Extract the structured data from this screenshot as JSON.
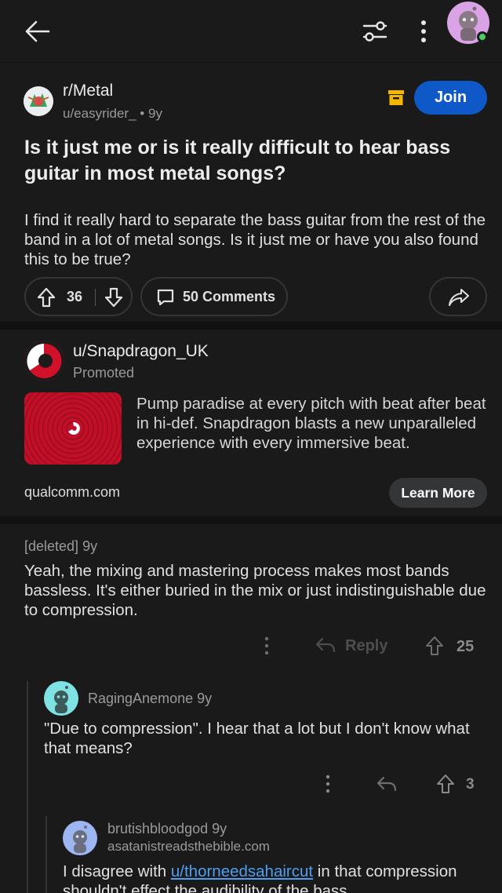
{
  "post": {
    "subreddit": "r/Metal",
    "author": "u/easyrider_",
    "age": "9y",
    "join_label": "Join",
    "title": "Is it just me or is it really difficult to hear bass guitar in most metal songs?",
    "body": "I find it really hard to separate the bass guitar from the rest of the band in a lot of metal songs. Is it just me or have you also found this to be true?",
    "score": "36",
    "comments_label": "50 Comments"
  },
  "ad": {
    "user": "u/Snapdragon_UK",
    "promoted": "Promoted",
    "text": "Pump paradise at every pitch with beat after beat in hi-def. Snapdragon blasts a new unparalleled experience with every immersive beat.",
    "domain": "qualcomm.com",
    "cta": "Learn More"
  },
  "comments": [
    {
      "author": "[deleted]",
      "age": "9y",
      "body": "Yeah, the mixing and mastering process makes most bands bassless. It's either buried in the mix or just indistinguishable due to compression.",
      "reply_label": "Reply",
      "score": "25"
    },
    {
      "author": "RagingAnemone",
      "age": "9y",
      "body": "\"Due to compression\".  I hear that a lot but I don't know what that means?",
      "score": "3"
    },
    {
      "author": "brutishbloodgod",
      "age": "9y",
      "flair": "asatanistreadsthebible.com",
      "body_before": "I disagree with ",
      "mention": "u/thorneedsahaircut",
      "body_after": " in that compression shouldn't effect the audibility of the bass"
    }
  ],
  "icons": {
    "back": "arrow-left-icon",
    "filter": "sliders-icon",
    "more": "vertical-dots-icon",
    "archive": "archive-icon",
    "upvote": "arrow-up-icon",
    "downvote": "arrow-down-icon",
    "comment": "speech-bubble-icon",
    "share": "share-arrow-icon",
    "reply": "reply-arrow-icon"
  },
  "colors": {
    "background": "#1a1a1b",
    "join_button": "#0f58c7",
    "link": "#4f9ff0",
    "archive": "#f5b700",
    "online": "#46d160"
  }
}
